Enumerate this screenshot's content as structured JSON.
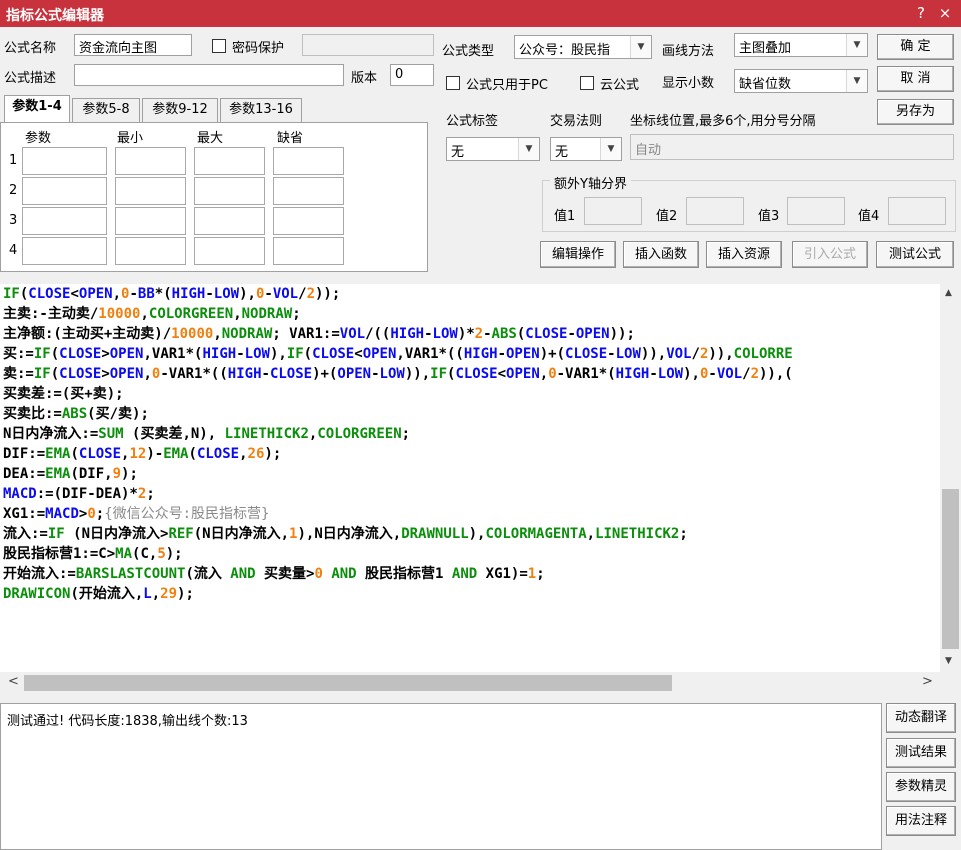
{
  "window": {
    "title": "指标公式编辑器",
    "help_glyph": "?",
    "close_glyph": "×"
  },
  "form": {
    "name_label": "公式名称",
    "name_value": "资金流向主图",
    "password_label": "密码保护",
    "type_label": "公式类型",
    "type_value": "公众号：股民指",
    "draw_label": "画线方法",
    "draw_value": "主图叠加",
    "desc_label": "公式描述",
    "desc_value": "",
    "version_label": "版本",
    "version_value": "0",
    "pc_only_label": "公式只用于PC",
    "cloud_label": "云公式",
    "decimals_label": "显示小数",
    "decimals_value": "缺省位数",
    "tag_label": "公式标签",
    "tag_value": "无",
    "trade_label": "交易法则",
    "trade_value": "无",
    "coord_label": "坐标线位置,最多6个,用分号分隔",
    "coord_placeholder": "自动",
    "extra_y_label": "额外Y轴分界",
    "y_values": [
      "值1",
      "值2",
      "值3",
      "值4"
    ]
  },
  "right_buttons": {
    "ok": "确  定",
    "cancel": "取  消",
    "save_as": "另存为"
  },
  "tabs": [
    "参数1-4",
    "参数5-8",
    "参数9-12",
    "参数13-16"
  ],
  "params": {
    "headers": [
      "参数",
      "最小",
      "最大",
      "缺省"
    ],
    "rows": [
      "1",
      "2",
      "3",
      "4"
    ]
  },
  "action_buttons": [
    "编辑操作",
    "插入函数",
    "插入资源",
    "引入公式",
    "测试公式"
  ],
  "code_lines": [
    [
      [
        "IF",
        "k"
      ],
      [
        "(",
        "p"
      ],
      [
        "CLOSE",
        "v"
      ],
      [
        "<",
        "p"
      ],
      [
        "OPEN",
        "v"
      ],
      [
        ",",
        "p"
      ],
      [
        "0",
        "n"
      ],
      [
        "-",
        "p"
      ],
      [
        "BB",
        "v"
      ],
      [
        "*(",
        "p"
      ],
      [
        "HIGH",
        "v"
      ],
      [
        "-",
        "p"
      ],
      [
        "LOW",
        "v"
      ],
      [
        "),",
        "p"
      ],
      [
        "0",
        "n"
      ],
      [
        "-",
        "p"
      ],
      [
        "VOL",
        "v"
      ],
      [
        "/",
        "p"
      ],
      [
        "2",
        "n"
      ],
      [
        "));",
        "p"
      ]
    ],
    [
      [
        "主卖:-主动卖/",
        "p"
      ],
      [
        "10000",
        "n"
      ],
      [
        ",",
        "p"
      ],
      [
        "COLORGREEN",
        "k"
      ],
      [
        ",",
        "p"
      ],
      [
        "NODRAW",
        "k"
      ],
      [
        ";",
        "p"
      ]
    ],
    [
      [
        "主净额:(主动买+主动卖)/",
        "p"
      ],
      [
        "10000",
        "n"
      ],
      [
        ",",
        "p"
      ],
      [
        "NODRAW",
        "k"
      ],
      [
        "; VAR1:=",
        "p"
      ],
      [
        "VOL",
        "v"
      ],
      [
        "/((",
        "p"
      ],
      [
        "HIGH",
        "v"
      ],
      [
        "-",
        "p"
      ],
      [
        "LOW",
        "v"
      ],
      [
        ")*",
        "p"
      ],
      [
        "2",
        "n"
      ],
      [
        "-",
        "p"
      ],
      [
        "ABS",
        "k"
      ],
      [
        "(",
        "p"
      ],
      [
        "CLOSE",
        "v"
      ],
      [
        "-",
        "p"
      ],
      [
        "OPEN",
        "v"
      ],
      [
        "));",
        "p"
      ]
    ],
    [
      [
        "买:=",
        "p"
      ],
      [
        "IF",
        "k"
      ],
      [
        "(",
        "p"
      ],
      [
        "CLOSE",
        "v"
      ],
      [
        ">",
        "p"
      ],
      [
        "OPEN",
        "v"
      ],
      [
        ",VAR1*(",
        "p"
      ],
      [
        "HIGH",
        "v"
      ],
      [
        "-",
        "p"
      ],
      [
        "LOW",
        "v"
      ],
      [
        "),",
        "p"
      ],
      [
        "IF",
        "k"
      ],
      [
        "(",
        "p"
      ],
      [
        "CLOSE",
        "v"
      ],
      [
        "<",
        "p"
      ],
      [
        "OPEN",
        "v"
      ],
      [
        ",VAR1*((",
        "p"
      ],
      [
        "HIGH",
        "v"
      ],
      [
        "-",
        "p"
      ],
      [
        "OPEN",
        "v"
      ],
      [
        ")+(",
        "p"
      ],
      [
        "CLOSE",
        "v"
      ],
      [
        "-",
        "p"
      ],
      [
        "LOW",
        "v"
      ],
      [
        ")),",
        "p"
      ],
      [
        "VOL",
        "v"
      ],
      [
        "/",
        "p"
      ],
      [
        "2",
        "n"
      ],
      [
        ")),",
        "p"
      ],
      [
        "COLORRE",
        "k"
      ]
    ],
    [
      [
        "卖:=",
        "p"
      ],
      [
        "IF",
        "k"
      ],
      [
        "(",
        "p"
      ],
      [
        "CLOSE",
        "v"
      ],
      [
        ">",
        "p"
      ],
      [
        "OPEN",
        "v"
      ],
      [
        ",",
        "p"
      ],
      [
        "0",
        "n"
      ],
      [
        "-VAR1*((",
        "p"
      ],
      [
        "HIGH",
        "v"
      ],
      [
        "-",
        "p"
      ],
      [
        "CLOSE",
        "v"
      ],
      [
        ")+(",
        "p"
      ],
      [
        "OPEN",
        "v"
      ],
      [
        "-",
        "p"
      ],
      [
        "LOW",
        "v"
      ],
      [
        ")),",
        "p"
      ],
      [
        "IF",
        "k"
      ],
      [
        "(",
        "p"
      ],
      [
        "CLOSE",
        "v"
      ],
      [
        "<",
        "p"
      ],
      [
        "OPEN",
        "v"
      ],
      [
        ",",
        "p"
      ],
      [
        "0",
        "n"
      ],
      [
        "-VAR1*(",
        "p"
      ],
      [
        "HIGH",
        "v"
      ],
      [
        "-",
        "p"
      ],
      [
        "LOW",
        "v"
      ],
      [
        "),",
        "p"
      ],
      [
        "0",
        "n"
      ],
      [
        "-",
        "p"
      ],
      [
        "VOL",
        "v"
      ],
      [
        "/",
        "p"
      ],
      [
        "2",
        "n"
      ],
      [
        ")),(",
        "p"
      ]
    ],
    [
      [
        "买卖差:=(买+卖);",
        "p"
      ]
    ],
    [
      [
        "买卖比:=",
        "p"
      ],
      [
        "ABS",
        "k"
      ],
      [
        "(买/卖);",
        "p"
      ]
    ],
    [
      [
        "N日内净流入:=",
        "p"
      ],
      [
        "SUM",
        "k"
      ],
      [
        " (买卖差,N), ",
        "p"
      ],
      [
        "LINETHICK2",
        "k"
      ],
      [
        ",",
        "p"
      ],
      [
        "COLORGREEN",
        "k"
      ],
      [
        ";",
        "p"
      ]
    ],
    [
      [
        "DIF:=",
        "p"
      ],
      [
        "EMA",
        "k"
      ],
      [
        "(",
        "p"
      ],
      [
        "CLOSE",
        "v"
      ],
      [
        ",",
        "p"
      ],
      [
        "12",
        "n"
      ],
      [
        ")-",
        "p"
      ],
      [
        "EMA",
        "k"
      ],
      [
        "(",
        "p"
      ],
      [
        "CLOSE",
        "v"
      ],
      [
        ",",
        "p"
      ],
      [
        "26",
        "n"
      ],
      [
        ");",
        "p"
      ]
    ],
    [
      [
        "DEA:=",
        "p"
      ],
      [
        "EMA",
        "k"
      ],
      [
        "(DIF,",
        "p"
      ],
      [
        "9",
        "n"
      ],
      [
        ");",
        "p"
      ]
    ],
    [
      [
        "MACD",
        "v"
      ],
      [
        ":=(DIF-DEA)*",
        "p"
      ],
      [
        "2",
        "n"
      ],
      [
        ";",
        "p"
      ]
    ],
    [
      [
        "XG1:=",
        "p"
      ],
      [
        "MACD",
        "v"
      ],
      [
        ">",
        "p"
      ],
      [
        "0",
        "n"
      ],
      [
        ";",
        "p"
      ],
      [
        "{微信公众号:股民指标营}",
        "c"
      ]
    ],
    [
      [
        "流入:=",
        "p"
      ],
      [
        "IF",
        "k"
      ],
      [
        " (N日内净流入>",
        "p"
      ],
      [
        "REF",
        "k"
      ],
      [
        "(N日内净流入,",
        "p"
      ],
      [
        "1",
        "n"
      ],
      [
        "),N日内净流入,",
        "p"
      ],
      [
        "DRAWNULL",
        "k"
      ],
      [
        "),",
        "p"
      ],
      [
        "COLORMAGENTA",
        "k"
      ],
      [
        ",",
        "p"
      ],
      [
        "LINETHICK2",
        "k"
      ],
      [
        ";",
        "p"
      ]
    ],
    [
      [
        "股民指标营1:=C>",
        "p"
      ],
      [
        "MA",
        "k"
      ],
      [
        "(C,",
        "p"
      ],
      [
        "5",
        "n"
      ],
      [
        ");",
        "p"
      ]
    ],
    [
      [
        "开始流入:=",
        "p"
      ],
      [
        "BARSLASTCOUNT",
        "k"
      ],
      [
        "(流入 ",
        "p"
      ],
      [
        "AND",
        "k"
      ],
      [
        " 买卖量>",
        "p"
      ],
      [
        "0",
        "n"
      ],
      [
        " ",
        "p"
      ],
      [
        "AND",
        "k"
      ],
      [
        " 股民指标营1 ",
        "p"
      ],
      [
        "AND",
        "k"
      ],
      [
        " XG1)=",
        "p"
      ],
      [
        "1",
        "n"
      ],
      [
        ";",
        "p"
      ]
    ],
    [
      [
        "DRAWICON",
        "k"
      ],
      [
        "(开始流入,",
        "p"
      ],
      [
        "L",
        "v"
      ],
      [
        ",",
        "p"
      ],
      [
        "29",
        "n"
      ],
      [
        ");",
        "p"
      ]
    ]
  ],
  "status": {
    "text": "测试通过! 代码长度:1838,输出线个数:13"
  },
  "side_buttons": [
    "动态翻译",
    "测试结果",
    "参数精灵",
    "用法注释"
  ],
  "scroll": {
    "up": "▲",
    "down": "▼",
    "left": "<",
    "right": ">"
  },
  "colors": {
    "title_bar": "#c8323c",
    "keyword": "#0b8e0b",
    "variable": "#0a0af0",
    "number": "#f08010"
  }
}
